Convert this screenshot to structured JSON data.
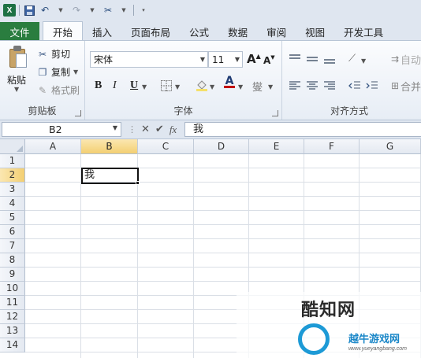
{
  "quick_access": {
    "icons": [
      "excel-icon",
      "save-icon",
      "undo-icon",
      "redo-icon",
      "customize-icon"
    ]
  },
  "tabs": [
    {
      "label": "文件"
    },
    {
      "label": "开始"
    },
    {
      "label": "插入"
    },
    {
      "label": "页面布局"
    },
    {
      "label": "公式"
    },
    {
      "label": "数据"
    },
    {
      "label": "审阅"
    },
    {
      "label": "视图"
    },
    {
      "label": "开发工具"
    }
  ],
  "ribbon": {
    "clipboard": {
      "group_label": "剪贴板",
      "paste": "粘贴",
      "cut": "剪切",
      "copy": "复制",
      "format_painter": "格式刷"
    },
    "font": {
      "group_label": "字体",
      "font_name": "宋体",
      "font_size": "11",
      "grow_label": "A",
      "shrink_label": "A",
      "bold": "B",
      "italic": "I",
      "underline": "U",
      "font_color_label": "A",
      "phonetic": "燮"
    },
    "alignment": {
      "group_label": "对齐方式",
      "wrap_text": "自动",
      "merge": "合并"
    }
  },
  "formula_bar": {
    "name_box": "B2",
    "fx_label": "fx",
    "content": "我"
  },
  "sheet": {
    "columns": [
      "A",
      "B",
      "C",
      "D",
      "E",
      "F",
      "G"
    ],
    "rows": [
      "1",
      "2",
      "3",
      "4",
      "5",
      "6",
      "7",
      "8",
      "9",
      "10",
      "11",
      "12",
      "13",
      "14"
    ],
    "selected_cell": "B2",
    "cells": {
      "B2": "我"
    }
  },
  "watermark": {
    "brand": "酷知网",
    "sub_brand": "越牛游戏网",
    "url": "www.yueyangbang.com"
  },
  "colors": {
    "file_tab": "#2a7d3f",
    "selection_header": "#f3cf72",
    "font_color_bar": "#c00000"
  }
}
